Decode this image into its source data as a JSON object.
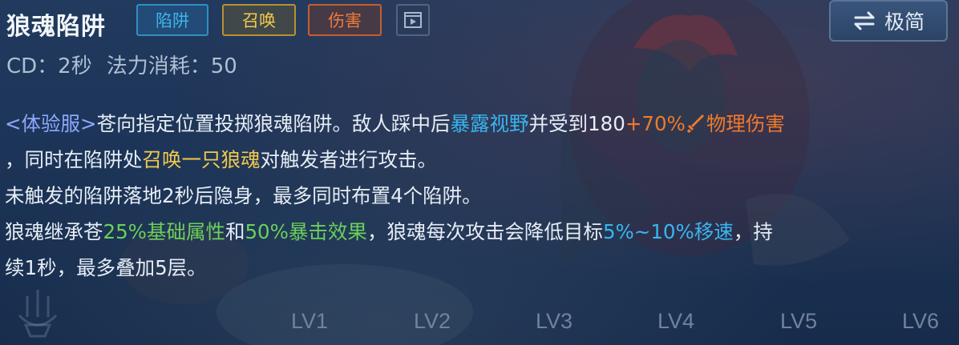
{
  "skill": {
    "name": "狼魂陷阱",
    "tags": {
      "trap": "陷阱",
      "summon": "召唤",
      "damage": "伤害"
    },
    "simple_button_label": "极简",
    "cd_text": "CD：2秒",
    "mana_text": "法力消耗：50"
  },
  "description": {
    "line1": {
      "prefix": "<体验服>",
      "t1": "苍向指定位置投掷狼魂陷阱。敌人踩中后",
      "reveal": "暴露视野",
      "t2": "并受到180",
      "bonus": "+70%",
      "damage_type": "物理伤害"
    },
    "line2": {
      "t1": "，同时在陷阱处",
      "summon": "召唤一只狼魂",
      "t2": "对触发者进行攻击。"
    },
    "line3": "未触发的陷阱落地2秒后隐身，最多同时布置4个陷阱。",
    "line4": {
      "t1": "狼魂继承苍",
      "attr": "25%基础属性",
      "t2": "和",
      "crit": "50%暴击效果",
      "t3": "，狼魂每次攻击会降低目标",
      "slow": "5%~10%移速",
      "t4": "，持"
    },
    "line5": "续1秒，最多叠加5层。"
  },
  "levels": [
    "LV1",
    "LV2",
    "LV3",
    "LV4",
    "LV5",
    "LV6"
  ],
  "icons": {
    "video": "video-play-icon",
    "swap": "swap-arrows-icon",
    "physical": "sword-icon",
    "emblem": "emblem-icon"
  },
  "colors": {
    "trap_tag": "#3fb4ea",
    "summon_tag": "#f2c94c",
    "damage_tag": "#f07a3a",
    "highlight_blue": "#38b6f0",
    "highlight_orange": "#f07a2a",
    "highlight_green": "#6bd05a",
    "prefix_purple": "#8ea8ff"
  }
}
